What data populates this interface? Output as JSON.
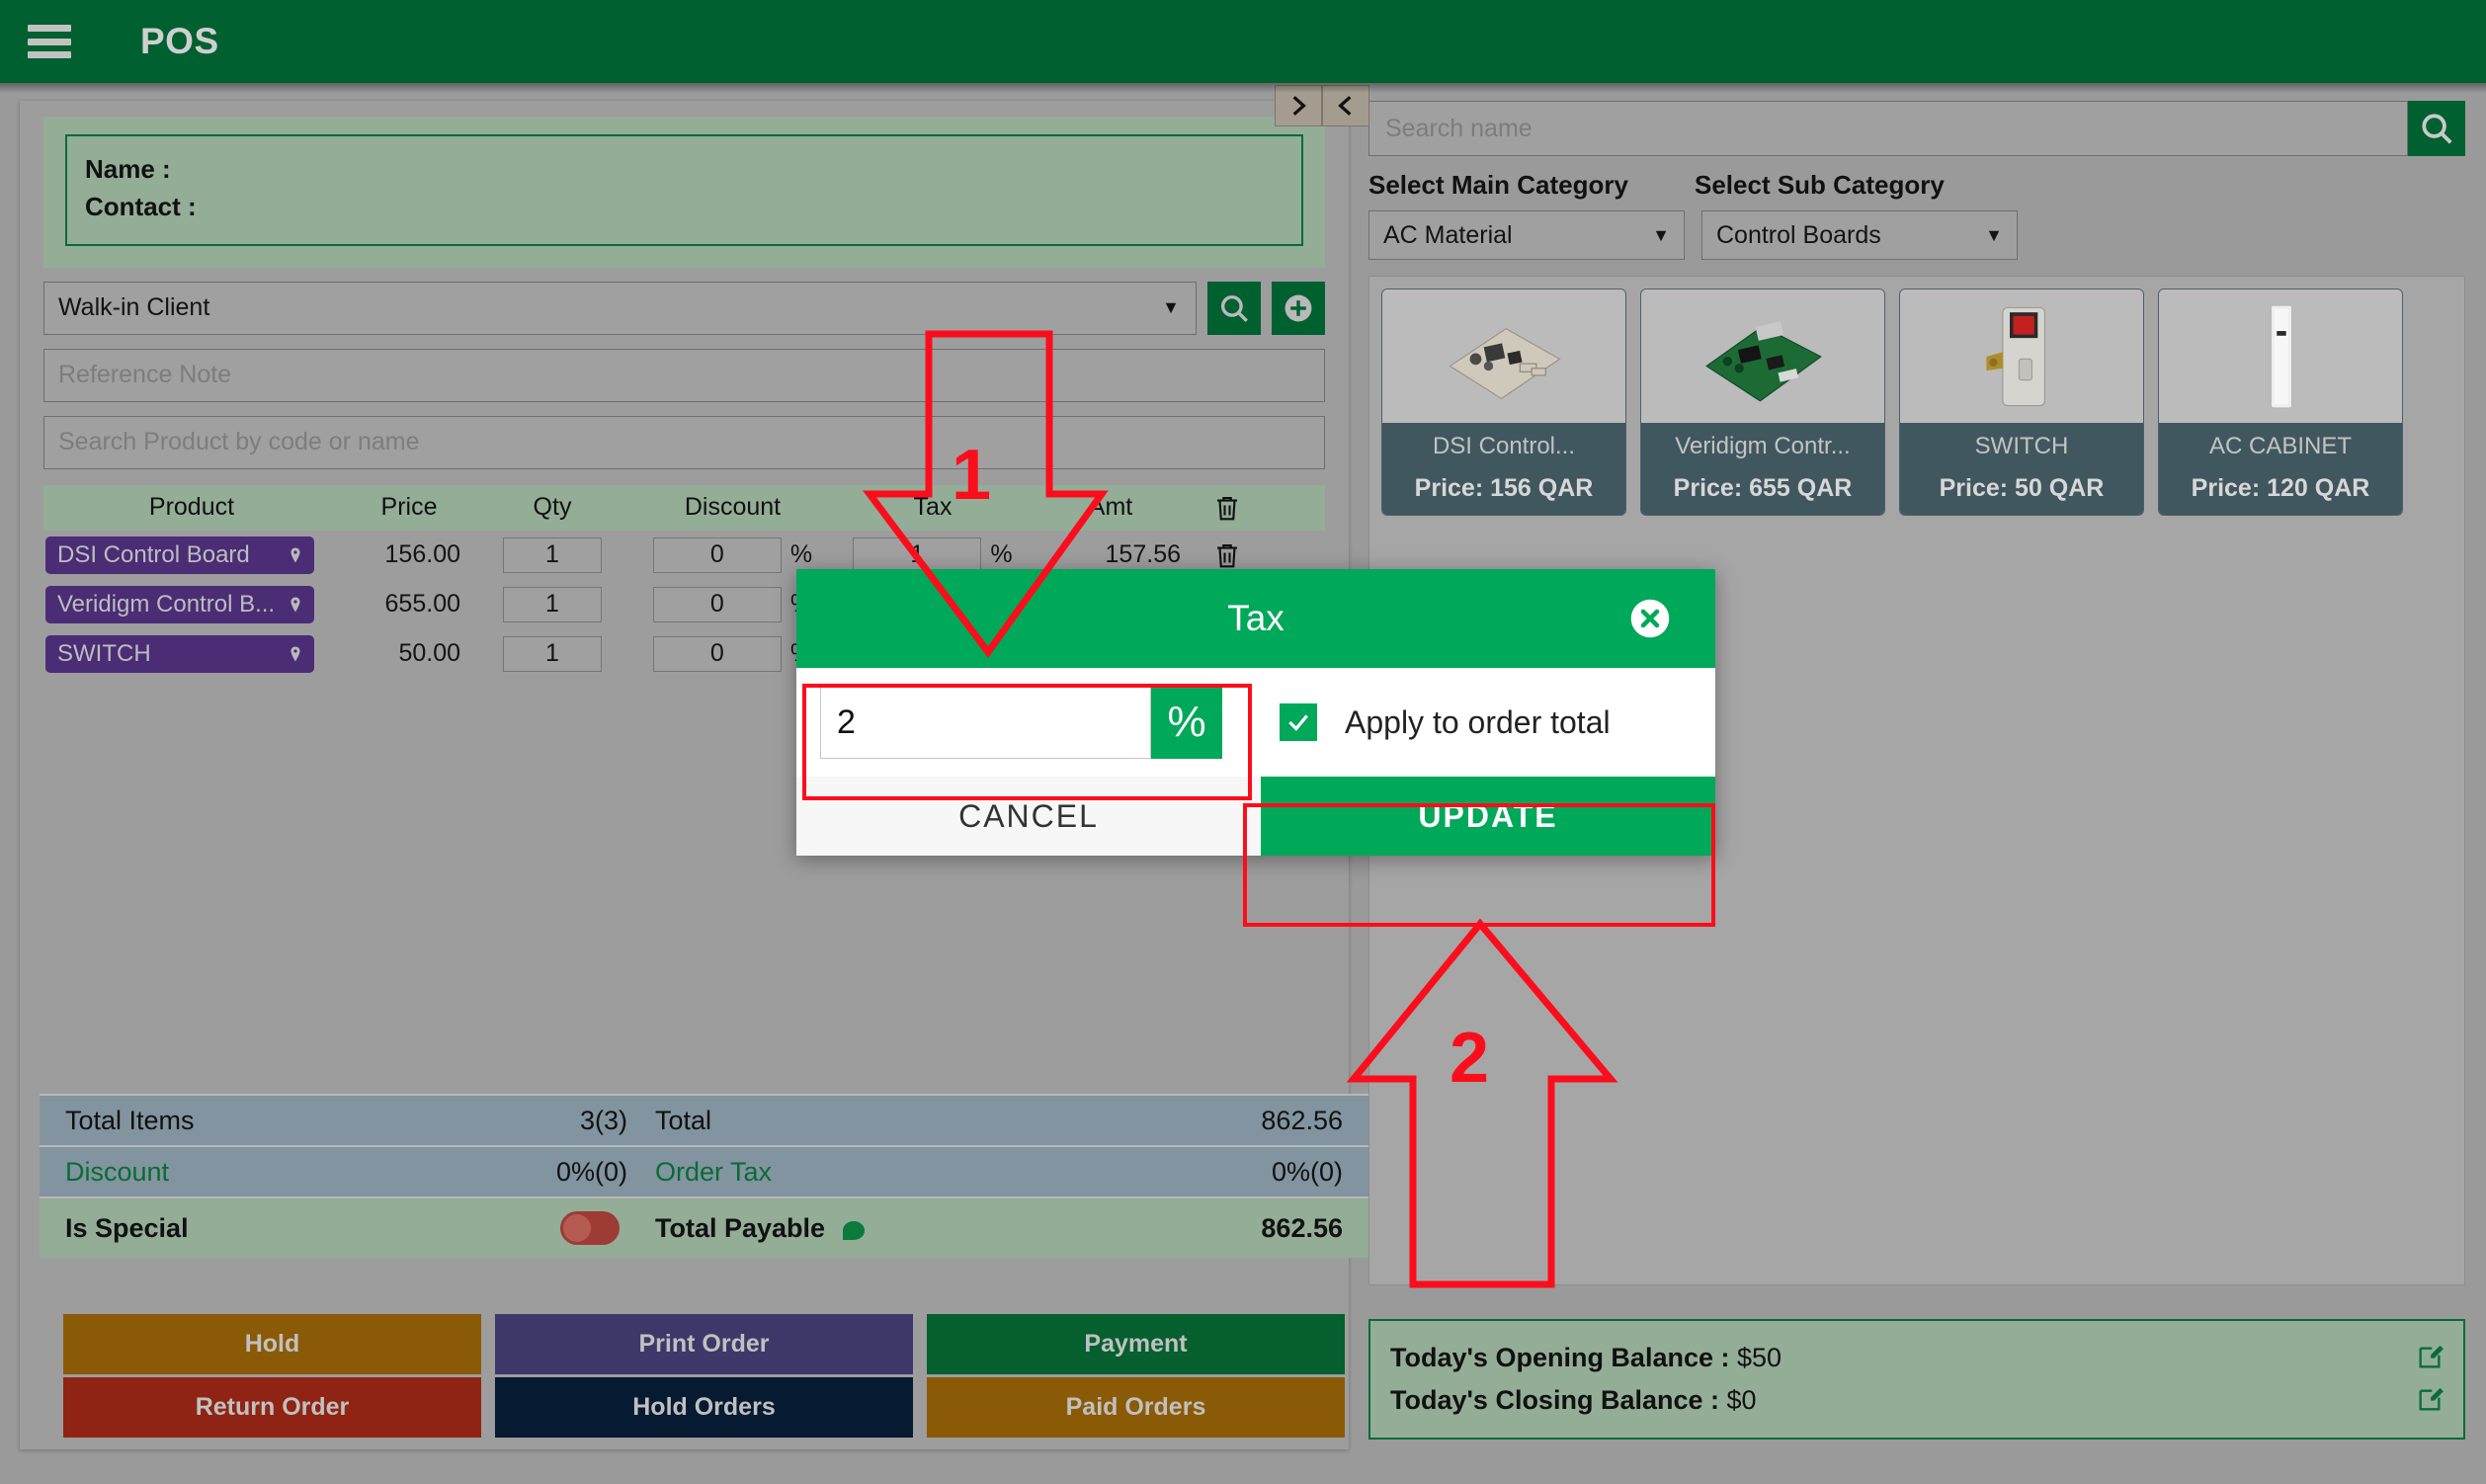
{
  "topbar": {
    "title": "POS",
    "menu_icon": "hamburger-icon"
  },
  "customer": {
    "name_label": "Name :",
    "contact_label": "Contact :",
    "selected_client": "Walk-in Client",
    "search_icon": "search-icon",
    "add_icon": "plus-circle-icon",
    "reference_note_placeholder": "Reference Note",
    "product_search_placeholder": "Search Product by code or name"
  },
  "cart": {
    "headers": [
      "Product",
      "Price",
      "Qty",
      "Discount",
      "Tax",
      "Amt"
    ],
    "delete_all_icon": "trash-icon",
    "rows": [
      {
        "product": "DSI Control Board",
        "price": "156.00",
        "qty": "1",
        "discount": "0",
        "discount_unit": "%",
        "tax": "1",
        "tax_unit": "%",
        "amt": "157.56",
        "pin_icon": "map-pin-icon",
        "delete_icon": "trash-icon"
      },
      {
        "product": "Veridigm Control B...",
        "price": "655.00",
        "qty": "1",
        "discount": "0",
        "discount_unit": "%",
        "tax": "",
        "tax_unit": "",
        "amt": "",
        "pin_icon": "map-pin-icon",
        "delete_icon": "trash-icon"
      },
      {
        "product": "SWITCH",
        "price": "50.00",
        "qty": "1",
        "discount": "0",
        "discount_unit": "%",
        "tax": "",
        "tax_unit": "",
        "amt": "",
        "pin_icon": "map-pin-icon",
        "delete_icon": "trash-icon"
      }
    ]
  },
  "totals": {
    "total_items_label": "Total Items",
    "total_items_value": "3(3)",
    "total_label": "Total",
    "total_value": "862.56",
    "discount_label": "Discount",
    "discount_value": "0%(0)",
    "order_tax_label": "Order Tax",
    "order_tax_value": "0%(0)",
    "is_special_label": "Is Special",
    "is_special_on": false,
    "total_payable_label": "Total Payable",
    "total_payable_value": "862.56"
  },
  "actions": {
    "hold": "Hold",
    "return_order": "Return Order",
    "print_order": "Print Order",
    "hold_orders": "Hold Orders",
    "payment": "Payment",
    "paid_orders": "Paid Orders"
  },
  "right": {
    "nav_next_icon": "chevron-right-icon",
    "nav_prev_icon": "chevron-left-icon",
    "search_placeholder": "Search name",
    "search_icon": "search-icon",
    "main_category_label": "Select Main Category",
    "main_category_value": "AC Material",
    "sub_category_label": "Select Sub Category",
    "sub_category_value": "Control Boards",
    "products": [
      {
        "name": "DSI Control...",
        "price": "Price: 156 QAR",
        "image": "circuit-board-image"
      },
      {
        "name": "Veridigm Contr...",
        "price": "Price: 655 QAR",
        "image": "circuit-board-image"
      },
      {
        "name": "SWITCH",
        "price": "Price: 50 QAR",
        "image": "switch-image"
      },
      {
        "name": "AC CABINET",
        "price": "Price: 120 QAR",
        "image": "cabinet-image"
      }
    ]
  },
  "balance": {
    "opening_label": "Today's Opening Balance :",
    "opening_value": "$50",
    "closing_label": "Today's Closing Balance :",
    "closing_value": "$0",
    "edit_icon": "edit-pencil-icon"
  },
  "modal": {
    "title": "Tax",
    "close_icon": "close-circle-icon",
    "tax_value": "2",
    "percent_symbol": "%",
    "apply_label": "Apply to order total",
    "apply_checked": true,
    "check_icon": "check-icon",
    "cancel_label": "CANCEL",
    "update_label": "UPDATE"
  },
  "annotations": {
    "step1": "1",
    "step2": "2",
    "color": "#fc0d1c"
  },
  "colors": {
    "header_green": "#006030",
    "modal_green": "#00a859",
    "product_tag_purple": "#4a2d75",
    "totals_blue": "#8194a0",
    "panel_green": "#93ad97"
  }
}
